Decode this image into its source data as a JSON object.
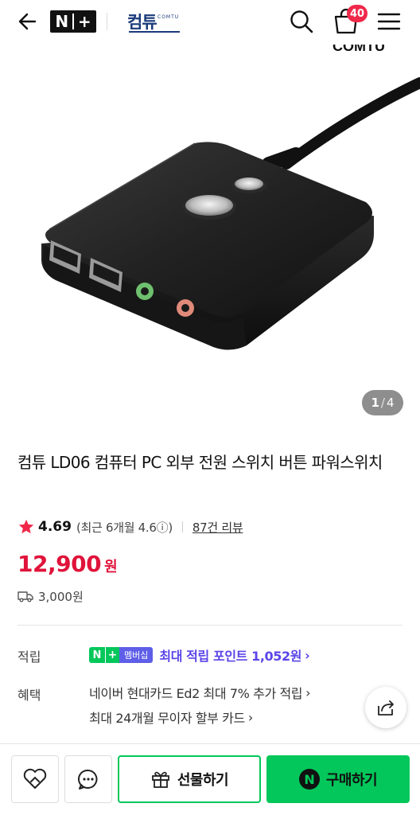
{
  "header": {
    "back_icon": "arrow-left-icon",
    "nplus_logo_n": "N",
    "nplus_logo_plus": "+",
    "brand_logo_text": "컴튜",
    "brand_logo_en": "COMTU",
    "search_icon": "search-icon",
    "cart_icon": "cart-icon",
    "cart_count": "40",
    "menu_icon": "menu-icon"
  },
  "gallery": {
    "current": "1",
    "separator": "/",
    "total": "4"
  },
  "product": {
    "title": "컴튜 LD06 컴퓨터 PC 외부 전원 스위치 버튼 파워스위치",
    "rating": "4.69",
    "recent_rating": "(최근 6개월 4.6ⓘ)",
    "review_link": "87건 리뷰",
    "price": "12,900",
    "price_unit": "원",
    "shipping": "3,000원"
  },
  "points": {
    "label": "적립",
    "badge_n": "N",
    "badge_plus": "+",
    "badge_member": "멤버십",
    "text": "최대 적립 포인트 1,052원",
    "chevron": "›"
  },
  "benefits": {
    "label": "혜택",
    "lines": [
      "네이버 현대카드 Ed2 최대 7% 추가 적립",
      "최대 24개월 무이자 할부 카드"
    ],
    "chevron": "›"
  },
  "bottom_bar": {
    "gift_label": "선물하기",
    "buy_label": "구매하기",
    "npay_letter": "N"
  },
  "colors": {
    "price": "#e0133a",
    "naver_green": "#03c75a",
    "points_purple": "#5a45e8",
    "badge_red": "#f0284a"
  }
}
